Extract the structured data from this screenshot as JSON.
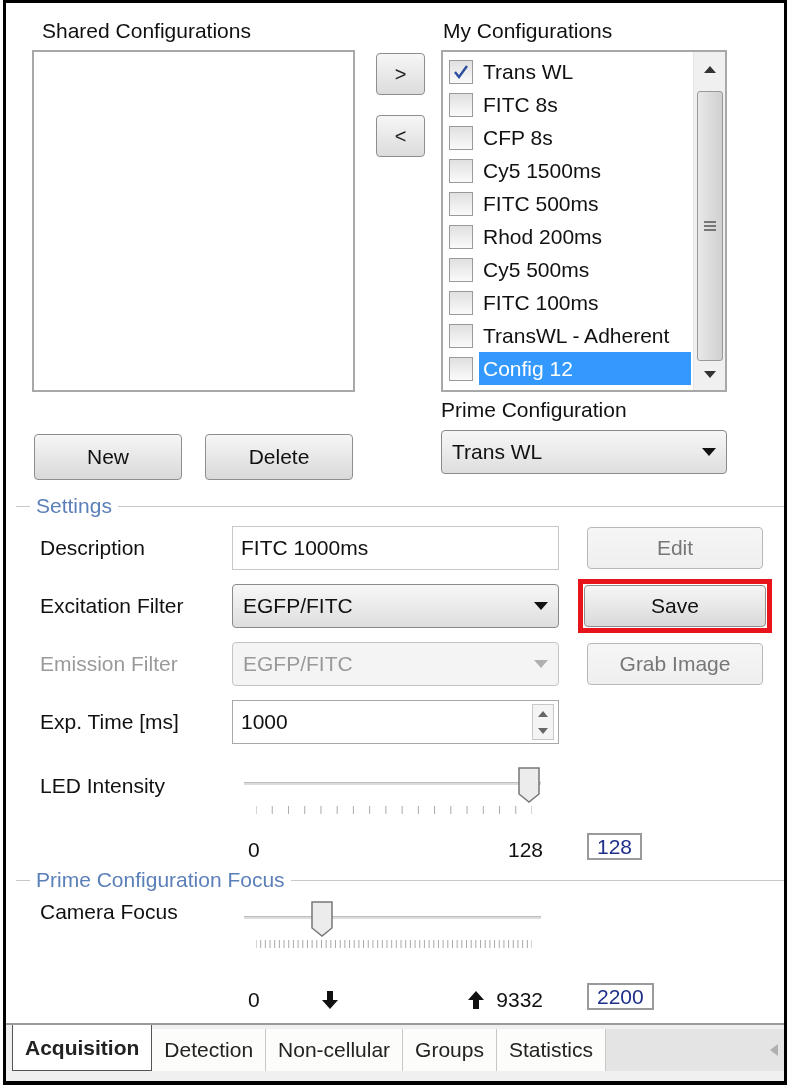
{
  "shared_configurations": {
    "label": "Shared Configurations"
  },
  "move_buttons": [
    ">",
    "<"
  ],
  "my_configurations": {
    "label": "My Configurations",
    "items": [
      {
        "label": "Trans WL",
        "checked": true,
        "selected": false
      },
      {
        "label": "FITC 8s",
        "checked": false,
        "selected": false
      },
      {
        "label": "CFP 8s",
        "checked": false,
        "selected": false
      },
      {
        "label": "Cy5 1500ms",
        "checked": false,
        "selected": false
      },
      {
        "label": "FITC 500ms",
        "checked": false,
        "selected": false
      },
      {
        "label": "Rhod 200ms",
        "checked": false,
        "selected": false
      },
      {
        "label": "Cy5 500ms",
        "checked": false,
        "selected": false
      },
      {
        "label": "FITC 100ms",
        "checked": false,
        "selected": false
      },
      {
        "label": "TransWL - Adherent",
        "checked": false,
        "selected": false
      },
      {
        "label": "Config 12",
        "checked": false,
        "selected": true
      }
    ]
  },
  "list_buttons": [
    "New",
    "Delete"
  ],
  "prime_configuration": {
    "label": "Prime Configuration",
    "value": "Trans WL"
  },
  "settings": {
    "title": "Settings",
    "fields": [
      {
        "kind": "text",
        "label": "Description",
        "value": "FITC 1000ms",
        "disabled": false
      },
      {
        "kind": "dropdown",
        "label": "Excitation Filter",
        "value": "EGFP/FITC",
        "disabled": false
      },
      {
        "kind": "dropdown",
        "label": "Emission Filter",
        "value": "EGFP/FITC",
        "disabled": true
      },
      {
        "kind": "spinner",
        "label": "Exp. Time [ms]",
        "value": "1000",
        "disabled": false
      }
    ],
    "buttons": [
      {
        "label": "Edit",
        "disabled": true,
        "highlighted": false
      },
      {
        "label": "Save",
        "disabled": false,
        "highlighted": true
      },
      {
        "label": "Grab Image",
        "disabled": true,
        "highlighted": false
      }
    ],
    "led_intensity": {
      "label": "LED Intensity",
      "level": 1,
      "min": "0",
      "max": "128",
      "reading": "128"
    }
  },
  "focus": {
    "title": "Prime Configuration Focus",
    "camera_focus": {
      "label": "Camera Focus",
      "level": 0.24,
      "min": "0",
      "max": "9332",
      "reading": "2200"
    }
  },
  "tabs": [
    {
      "label": "Acquisition",
      "selected": true
    },
    {
      "label": "Detection",
      "selected": false
    },
    {
      "label": "Non-cellular",
      "selected": false
    },
    {
      "label": "Groups",
      "selected": false
    },
    {
      "label": "Statistics",
      "selected": false
    }
  ]
}
